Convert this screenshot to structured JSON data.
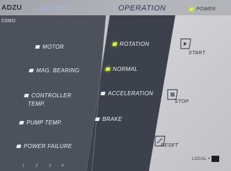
{
  "header": {
    "brand": "ADZU",
    "model": "03MD",
    "alarm_title": "ALARM",
    "operation_title": "OPERATION",
    "power_label": "POWER"
  },
  "alarm": {
    "items": [
      {
        "label": "MOTOR"
      },
      {
        "label": "MAG. BEARING"
      },
      {
        "label": "CONTROLLER",
        "label2": "TEMP."
      },
      {
        "label": "PUMP TEMP."
      },
      {
        "label": "POWER  FAILURE"
      }
    ],
    "numbers": [
      "1",
      "2",
      "3",
      "4"
    ]
  },
  "operation": {
    "items": [
      {
        "label": "ROTATION"
      },
      {
        "label": "NORMAL"
      },
      {
        "label": "ACCELERATION"
      },
      {
        "label": "BRAKE"
      }
    ]
  },
  "buttons": {
    "start": "START",
    "stop": "STOP",
    "reset": "RESET"
  },
  "footer": {
    "local_label": "LOCAL",
    "dot": "•",
    "dash": "-"
  },
  "colors": {
    "alarm_panel": "#4b4f5a",
    "operation_panel": "#3f434d",
    "lamp_on": "#d8f040",
    "lamp_off": "#e9ecef"
  }
}
